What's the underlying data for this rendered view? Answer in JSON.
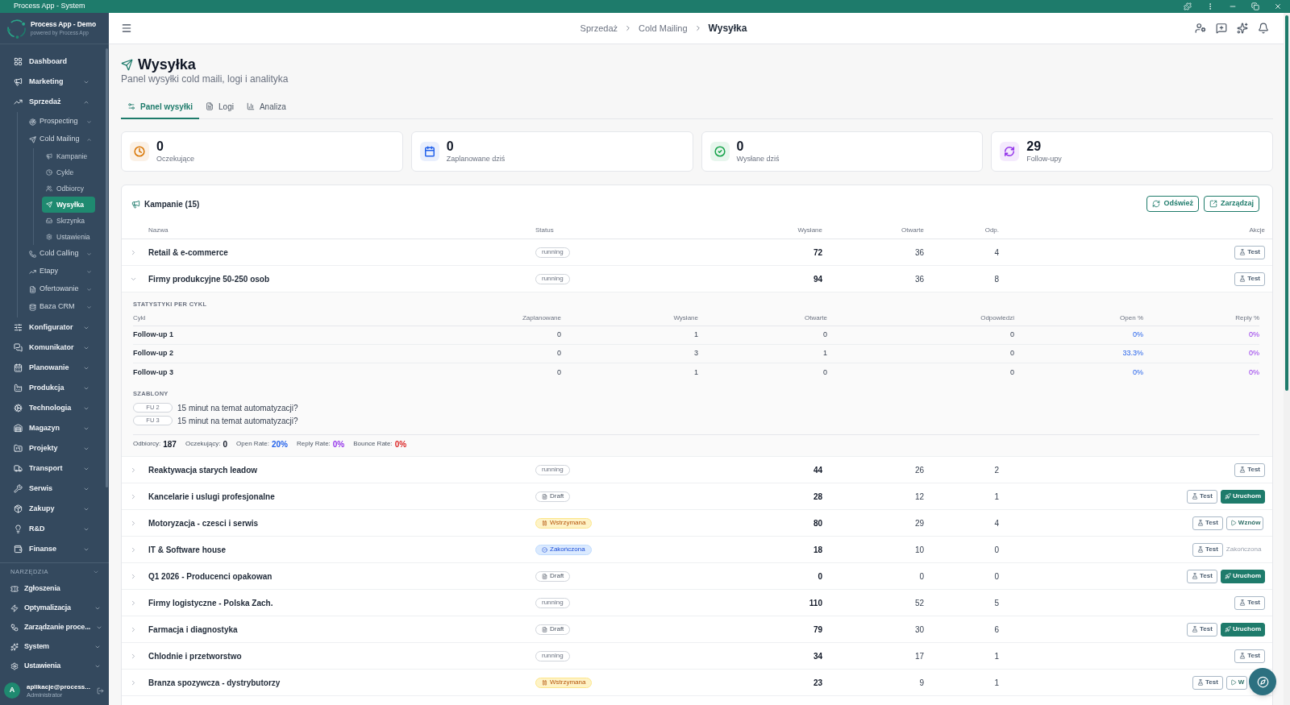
{
  "window": {
    "title": "Process App - System"
  },
  "sidebar": {
    "brand": {
      "name": "Process App - Demo",
      "tagline": "powered by Process App"
    },
    "nav": [
      {
        "label": "Dashboard",
        "selected": false
      },
      {
        "label": "Marketing",
        "selected": false,
        "expanded": false
      },
      {
        "label": "Sprzedaż",
        "selected": false,
        "expanded": true,
        "children": [
          {
            "label": "Prospecting",
            "selected": false,
            "expanded": false
          },
          {
            "label": "Cold Mailing",
            "selected": false,
            "expanded": true,
            "children": [
              {
                "label": "Kampanie",
                "selected": false
              },
              {
                "label": "Cykle",
                "selected": false
              },
              {
                "label": "Odbiorcy",
                "selected": false
              },
              {
                "label": "Wysyłka",
                "selected": true
              },
              {
                "label": "Skrzynka",
                "selected": false
              },
              {
                "label": "Ustawienia",
                "selected": false
              }
            ]
          },
          {
            "label": "Cold Calling",
            "selected": false,
            "expanded": false
          },
          {
            "label": "Etapy",
            "selected": false,
            "expanded": false
          },
          {
            "label": "Ofertowanie",
            "selected": false,
            "expanded": false
          },
          {
            "label": "Baza CRM",
            "selected": false,
            "expanded": false
          }
        ]
      },
      {
        "label": "Konfigurator",
        "selected": false,
        "expanded": false
      },
      {
        "label": "Komunikator",
        "selected": false,
        "expanded": false
      },
      {
        "label": "Planowanie",
        "selected": false,
        "expanded": false
      },
      {
        "label": "Produkcja",
        "selected": false,
        "expanded": false
      },
      {
        "label": "Technologia",
        "selected": false,
        "expanded": false
      },
      {
        "label": "Magazyn",
        "selected": false,
        "expanded": false
      },
      {
        "label": "Projekty",
        "selected": false,
        "expanded": false
      },
      {
        "label": "Transport",
        "selected": false,
        "expanded": false
      },
      {
        "label": "Serwis",
        "selected": false,
        "expanded": false
      },
      {
        "label": "Zakupy",
        "selected": false,
        "expanded": false
      },
      {
        "label": "R&D",
        "selected": false,
        "expanded": false
      },
      {
        "label": "Finanse",
        "selected": false,
        "expanded": false
      }
    ],
    "tools": {
      "title": "NARZĘDZIA",
      "items": [
        {
          "label": "Zgłoszenia",
          "selected": false
        },
        {
          "label": "Optymalizacja",
          "selected": false,
          "expanded": false
        },
        {
          "label": "Zarządzanie proce...",
          "selected": false,
          "expanded": false
        },
        {
          "label": "System",
          "selected": false,
          "expanded": false
        },
        {
          "label": "Ustawienia",
          "selected": false,
          "expanded": false
        }
      ]
    },
    "user": {
      "initial": "A",
      "email": "aplikacje@process...",
      "role": "Administrator"
    }
  },
  "header": {
    "breadcrumb": [
      {
        "label": "Sprzedaż",
        "current": false
      },
      {
        "label": "Cold Mailing",
        "current": false
      },
      {
        "label": "Wysyłka",
        "current": true
      }
    ]
  },
  "page": {
    "title": "Wysyłka",
    "subtitle": "Panel wysyłki cold maili, logi i analityka"
  },
  "tabs": [
    {
      "label": "Panel wysyłki",
      "selected": true
    },
    {
      "label": "Logi",
      "selected": false
    },
    {
      "label": "Analiza",
      "selected": false
    }
  ],
  "stats": [
    {
      "value": "0",
      "label": "Oczekujące",
      "color": "#d97706"
    },
    {
      "value": "0",
      "label": "Zaplanowane dziś",
      "color": "#2563eb"
    },
    {
      "value": "0",
      "label": "Wysłane dziś",
      "color": "#16a34a"
    },
    {
      "value": "29",
      "label": "Follow-upy",
      "color": "#9333ea"
    }
  ],
  "campaigns": {
    "title": "Kampanie (15)",
    "buttons": [
      "Odśwież",
      "Zarządzaj"
    ],
    "columns": [
      "Nazwa",
      "Status",
      "Wysłane",
      "Otwarte",
      "Odp.",
      "Akcje"
    ],
    "rows": [
      {
        "name": "Retail & e-commerce",
        "status": {
          "kind": "running",
          "label": "running"
        },
        "sent": "72",
        "opened": "36",
        "replies": "4",
        "expanded": false,
        "actions": [
          {
            "kind": "test",
            "label": "Test"
          }
        ]
      },
      {
        "name": "Firmy produkcyjne 50-250 osob",
        "status": {
          "kind": "running",
          "label": "running"
        },
        "sent": "94",
        "opened": "36",
        "replies": "8",
        "expanded": true,
        "actions": [
          {
            "kind": "test",
            "label": "Test"
          }
        ],
        "details": {
          "stats_title": "STATYSTYKI PER CYKL",
          "columns": [
            "Cykl",
            "Zaplanowane",
            "Wysłane",
            "Otwarte",
            "Odpowiedzi",
            "Open %",
            "Reply %"
          ],
          "rows": [
            {
              "cycle": "Follow-up 1",
              "planned": "0",
              "sent": "1",
              "opened": "0",
              "replies": "0",
              "open_rate": "0%",
              "reply_rate": "0%"
            },
            {
              "cycle": "Follow-up 2",
              "planned": "0",
              "sent": "3",
              "opened": "1",
              "replies": "0",
              "open_rate": "33.3%",
              "reply_rate": "0%"
            },
            {
              "cycle": "Follow-up 3",
              "planned": "0",
              "sent": "1",
              "opened": "0",
              "replies": "0",
              "open_rate": "0%",
              "reply_rate": "0%"
            }
          ],
          "templates_title": "SZABLONY",
          "templates": [
            {
              "tag": "FU 2",
              "subject": "15 minut na temat automatyzacji?"
            },
            {
              "tag": "FU 3",
              "subject": "15 minut na temat automatyzacji?"
            }
          ],
          "summary": [
            {
              "label": "Odbiorcy:",
              "value": "187",
              "color": "#111827"
            },
            {
              "label": "Oczekujący:",
              "value": "0",
              "color": "#111827"
            },
            {
              "label": "Open Rate:",
              "value": "20%",
              "color": "#2563eb"
            },
            {
              "label": "Reply Rate:",
              "value": "0%",
              "color": "#9333ea"
            },
            {
              "label": "Bounce Rate:",
              "value": "0%",
              "color": "#dc2626"
            }
          ]
        }
      },
      {
        "name": "Reaktywacja starych leadow",
        "status": {
          "kind": "running",
          "label": "running"
        },
        "sent": "44",
        "opened": "26",
        "replies": "2",
        "expanded": false,
        "actions": [
          {
            "kind": "test",
            "label": "Test"
          }
        ]
      },
      {
        "name": "Kancelarie i uslugi profesjonalne",
        "status": {
          "kind": "draft",
          "label": "Draft"
        },
        "sent": "28",
        "opened": "12",
        "replies": "1",
        "expanded": false,
        "actions": [
          {
            "kind": "test",
            "label": "Test"
          },
          {
            "kind": "start",
            "label": "Uruchom"
          }
        ]
      },
      {
        "name": "Motoryzacja - czesci i serwis",
        "status": {
          "kind": "paused",
          "label": "Wstrzymana"
        },
        "sent": "80",
        "opened": "29",
        "replies": "4",
        "expanded": false,
        "actions": [
          {
            "kind": "test",
            "label": "Test"
          },
          {
            "kind": "resume",
            "label": "Wznów"
          }
        ]
      },
      {
        "name": "IT & Software house",
        "status": {
          "kind": "completed",
          "label": "Zakończona"
        },
        "sent": "18",
        "opened": "10",
        "replies": "0",
        "expanded": false,
        "actions": [
          {
            "kind": "test",
            "label": "Test"
          },
          {
            "kind": "ended",
            "label": "Zakończona"
          }
        ]
      },
      {
        "name": "Q1 2026 - Producenci opakowan",
        "status": {
          "kind": "draft",
          "label": "Draft"
        },
        "sent": "0",
        "opened": "0",
        "replies": "0",
        "expanded": false,
        "actions": [
          {
            "kind": "test",
            "label": "Test"
          },
          {
            "kind": "start",
            "label": "Uruchom"
          }
        ]
      },
      {
        "name": "Firmy logistyczne - Polska Zach.",
        "status": {
          "kind": "running",
          "label": "running"
        },
        "sent": "110",
        "opened": "52",
        "replies": "5",
        "expanded": false,
        "actions": [
          {
            "kind": "test",
            "label": "Test"
          }
        ]
      },
      {
        "name": "Farmacja i diagnostyka",
        "status": {
          "kind": "draft",
          "label": "Draft"
        },
        "sent": "79",
        "opened": "30",
        "replies": "6",
        "expanded": false,
        "actions": [
          {
            "kind": "test",
            "label": "Test"
          },
          {
            "kind": "start",
            "label": "Uruchom"
          }
        ]
      },
      {
        "name": "Chlodnie i przetworstwo",
        "status": {
          "kind": "running",
          "label": "running"
        },
        "sent": "34",
        "opened": "17",
        "replies": "1",
        "expanded": false,
        "actions": [
          {
            "kind": "test",
            "label": "Test"
          }
        ]
      },
      {
        "name": "Branza spozywcza - dystrybutorzy",
        "status": {
          "kind": "paused",
          "label": "Wstrzymana"
        },
        "sent": "23",
        "opened": "9",
        "replies": "1",
        "expanded": false,
        "actions": [
          {
            "kind": "test",
            "label": "Test"
          },
          {
            "kind": "resume",
            "label": "W"
          }
        ]
      }
    ]
  }
}
